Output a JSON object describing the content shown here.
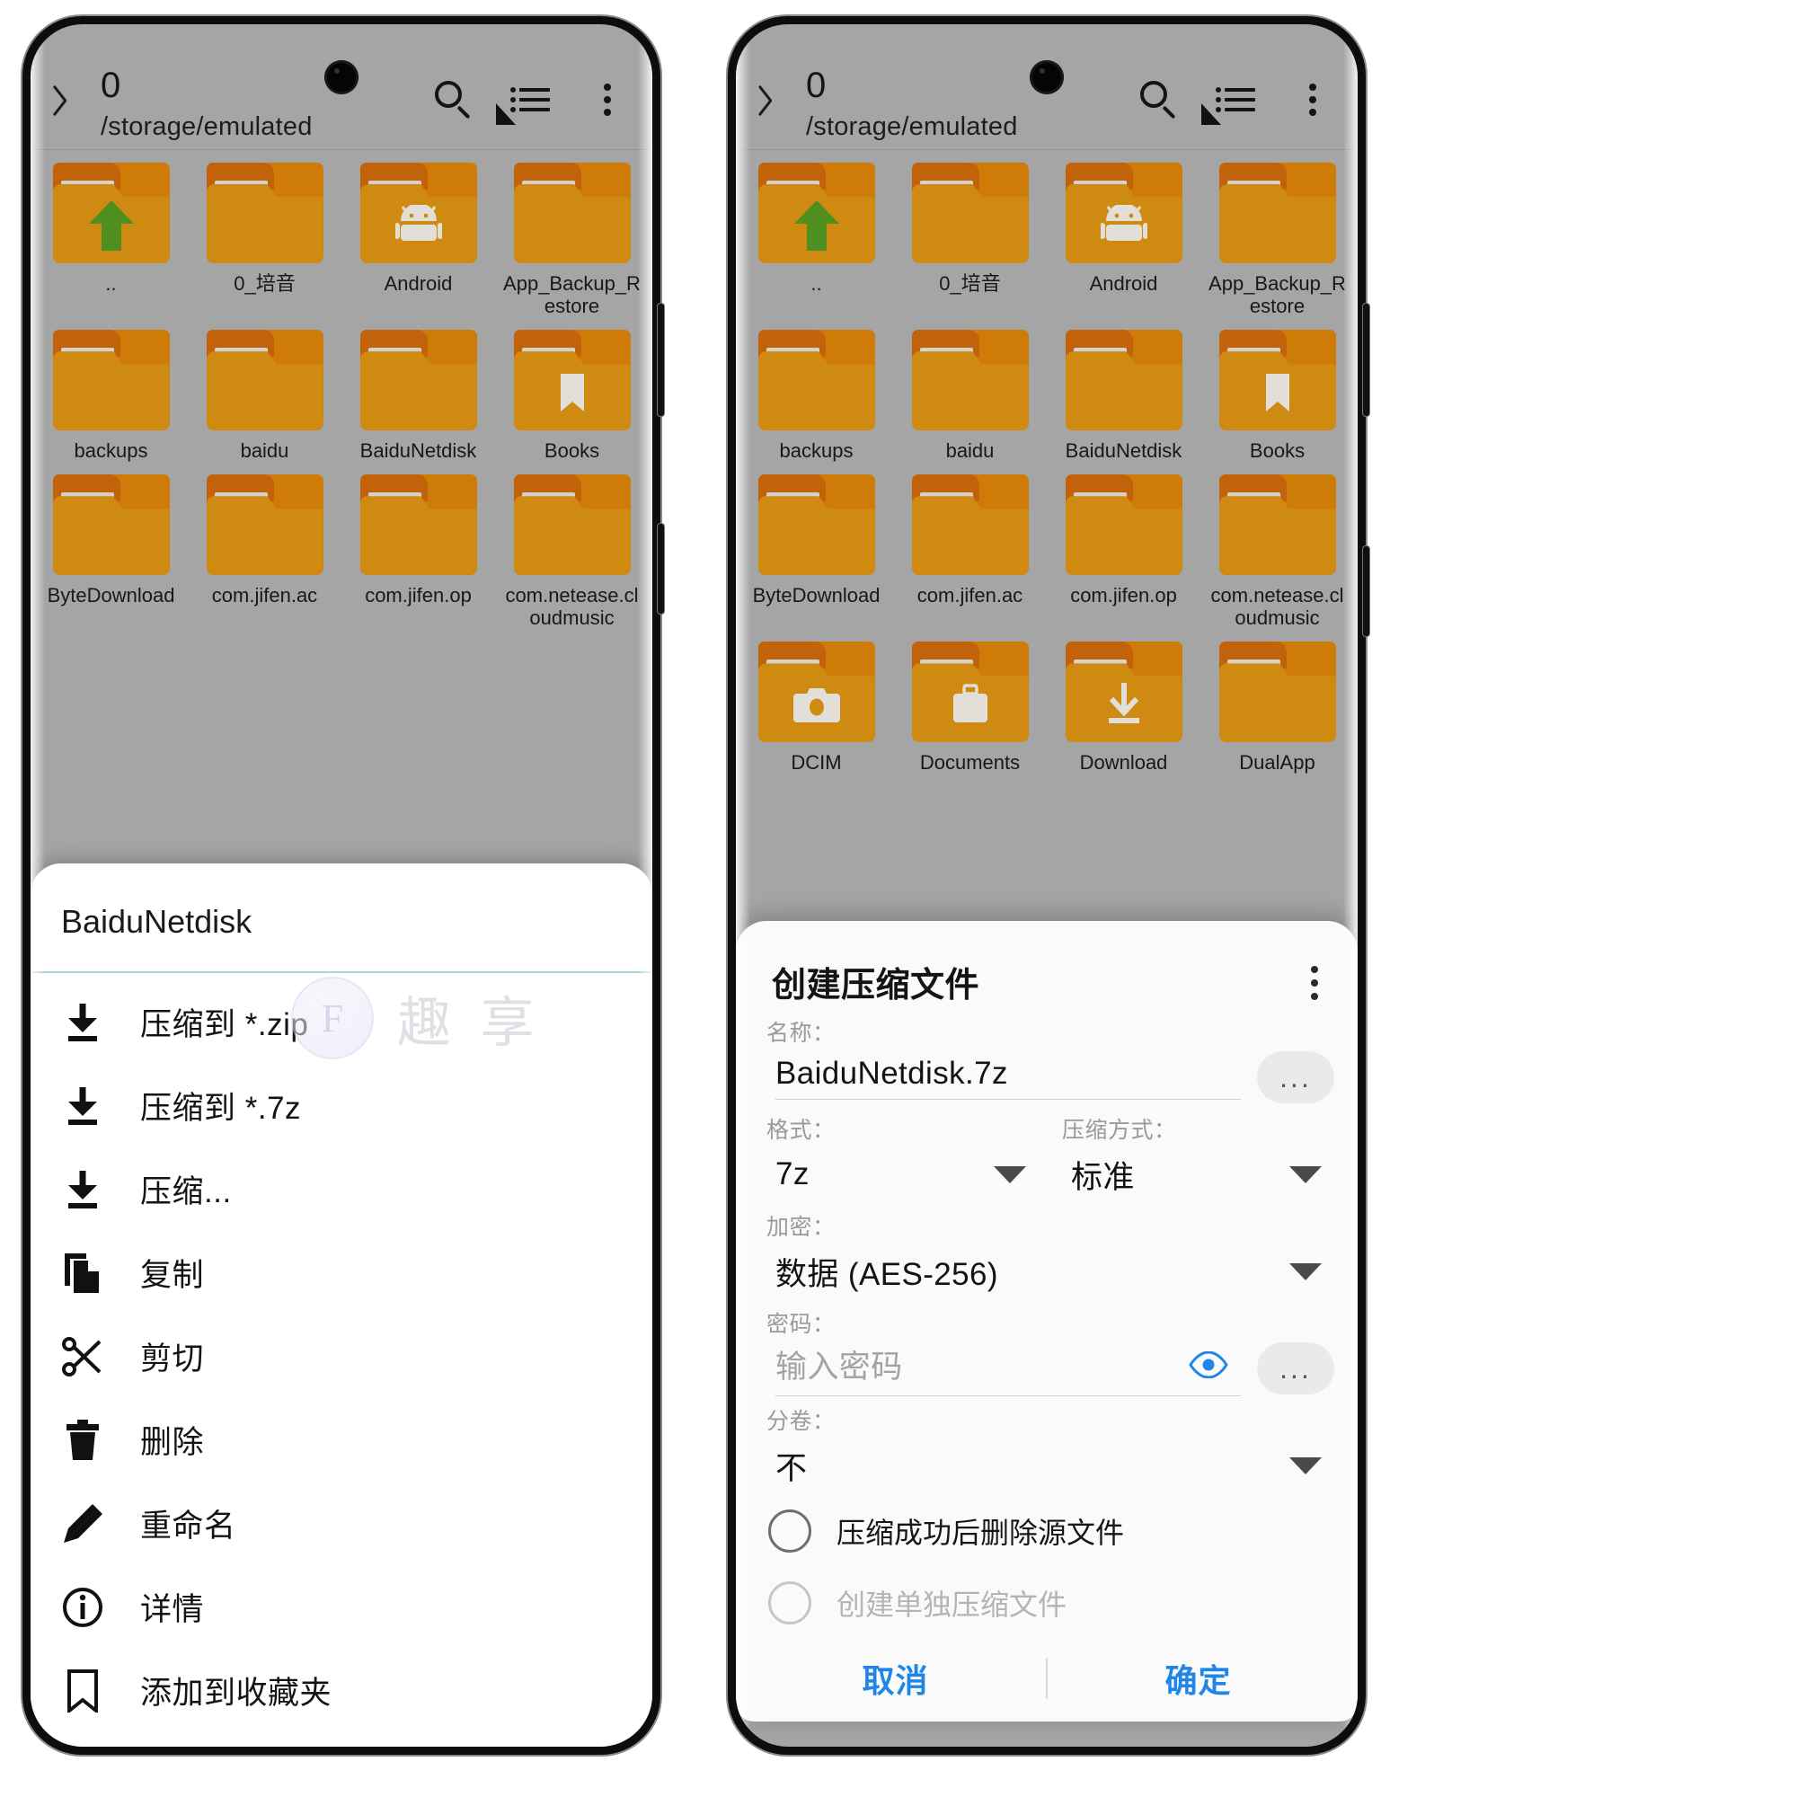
{
  "app": {
    "appbar": {
      "title": "0",
      "path": "/storage/emulated",
      "back_icon": "back-chevron-icon",
      "search_icon": "search-icon",
      "list_icon": "list-view-icon",
      "overflow_icon": "more-vertical-icon"
    },
    "folders_left": [
      {
        "label": "..",
        "badge": "up-arrow"
      },
      {
        "label": "0_培音",
        "badge": "none"
      },
      {
        "label": "Android",
        "badge": "android"
      },
      {
        "label": "App_Backup_Restore",
        "badge": "none"
      },
      {
        "label": "backups",
        "badge": "none"
      },
      {
        "label": "baidu",
        "badge": "none"
      },
      {
        "label": "BaiduNetdisk",
        "badge": "none"
      },
      {
        "label": "Books",
        "badge": "bookmark"
      },
      {
        "label": "ByteDownload",
        "badge": "none"
      },
      {
        "label": "com.jifen.ac",
        "badge": "none"
      },
      {
        "label": "com.jifen.op",
        "badge": "none"
      },
      {
        "label": "com.netease.cloudmusic",
        "badge": "none"
      }
    ],
    "folders_right": [
      {
        "label": "..",
        "badge": "up-arrow"
      },
      {
        "label": "0_培音",
        "badge": "none"
      },
      {
        "label": "Android",
        "badge": "android"
      },
      {
        "label": "App_Backup_Restore",
        "badge": "none"
      },
      {
        "label": "backups",
        "badge": "none"
      },
      {
        "label": "baidu",
        "badge": "none"
      },
      {
        "label": "BaiduNetdisk",
        "badge": "none"
      },
      {
        "label": "Books",
        "badge": "bookmark"
      },
      {
        "label": "ByteDownload",
        "badge": "none"
      },
      {
        "label": "com.jifen.ac",
        "badge": "none"
      },
      {
        "label": "com.jifen.op",
        "badge": "none"
      },
      {
        "label": "com.netease.cloudmusic",
        "badge": "none"
      },
      {
        "label": "DCIM",
        "badge": "camera"
      },
      {
        "label": "Documents",
        "badge": "briefcase"
      },
      {
        "label": "Download",
        "badge": "download"
      },
      {
        "label": "DualApp",
        "badge": "none"
      }
    ]
  },
  "sheet": {
    "title": "BaiduNetdisk",
    "items": [
      {
        "label": "压缩到 *.zip",
        "icon": "download-arrow-icon"
      },
      {
        "label": "压缩到 *.7z",
        "icon": "download-arrow-icon"
      },
      {
        "label": "压缩...",
        "icon": "download-arrow-icon"
      },
      {
        "label": "复制",
        "icon": "copy-icon"
      },
      {
        "label": "剪切",
        "icon": "scissors-icon"
      },
      {
        "label": "删除",
        "icon": "trash-icon"
      },
      {
        "label": "重命名",
        "icon": "pencil-icon"
      },
      {
        "label": "详情",
        "icon": "info-icon"
      },
      {
        "label": "添加到收藏夹",
        "icon": "bookmark-icon"
      }
    ]
  },
  "dialog": {
    "title": "创建压缩文件",
    "overflow_icon": "more-vertical-icon",
    "name": {
      "label": "名称：",
      "value": "BaiduNetdisk.7z",
      "more_label": "..."
    },
    "format": {
      "label": "格式：",
      "value": "7z"
    },
    "method": {
      "label": "压缩方式：",
      "value": "标准"
    },
    "encryption": {
      "label": "加密：",
      "value": "数据 (AES-256)"
    },
    "password": {
      "label": "密码：",
      "placeholder": "输入密码",
      "value": "",
      "reveal_icon": "eye-icon",
      "more_label": "..."
    },
    "volume": {
      "label": "分卷：",
      "value": "不"
    },
    "checkboxes": [
      {
        "label": "压缩成功后删除源文件",
        "checked": false,
        "disabled": false
      },
      {
        "label": "创建单独压缩文件",
        "checked": false,
        "disabled": true
      }
    ],
    "cancel_label": "取消",
    "ok_label": "确定",
    "accent_color": "#1f86e8"
  },
  "watermark": {
    "mark": "F",
    "text": "趣 享"
  },
  "colors": {
    "folder_body": "#cf8a12",
    "folder_tab": "#c2620a",
    "screen_bg": "#a5a5a5",
    "sheet_bg": "#ffffff",
    "dialog_bg": "#fafafa",
    "divider": "#a8d4dc",
    "accent": "#1f86e8"
  }
}
